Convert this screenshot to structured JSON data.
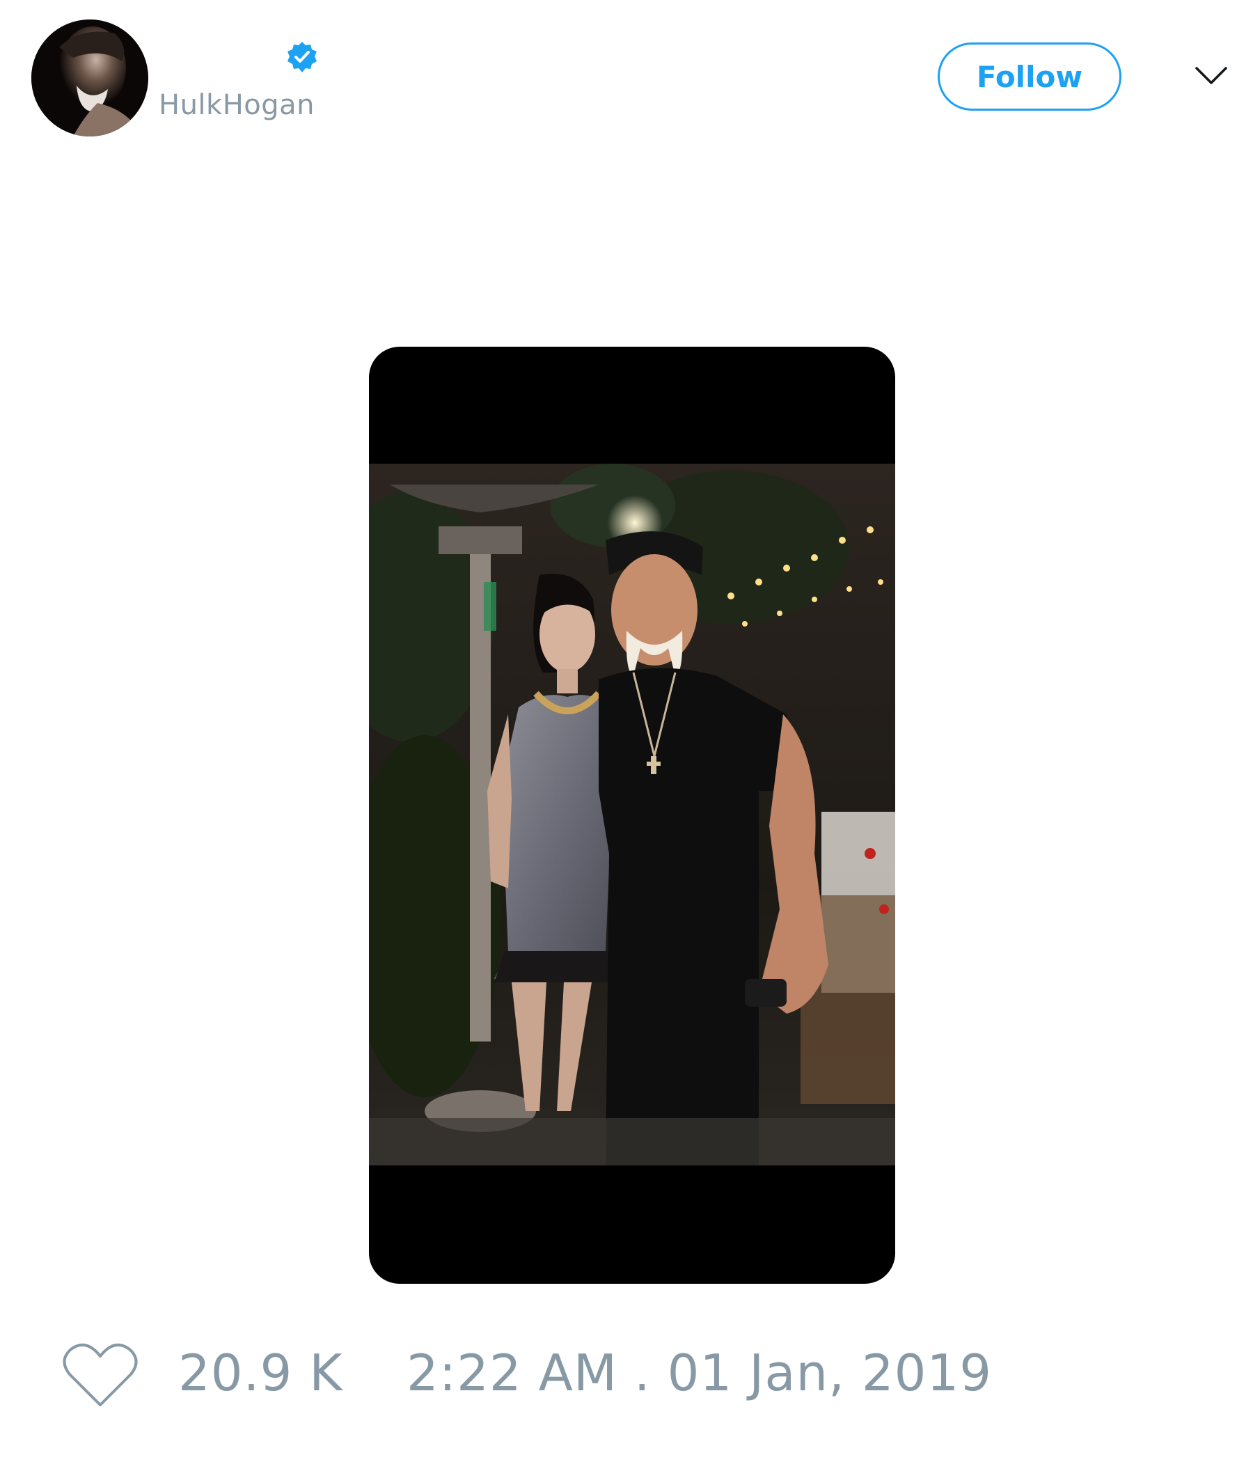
{
  "tweet": {
    "author": {
      "display_name": "",
      "handle": "HulkHogan",
      "verified": true
    },
    "follow_label": "Follow",
    "likes": "20.9 K",
    "timestamp": "2:22 AM . 01 Jan, 2019"
  },
  "icons": {
    "verified": "verified-badge-icon",
    "menu": "chevron-down-icon",
    "like": "heart-outline-icon"
  },
  "colors": {
    "accent": "#1da1f2",
    "muted_text": "#8899a6",
    "media_letterbox": "#000000"
  }
}
